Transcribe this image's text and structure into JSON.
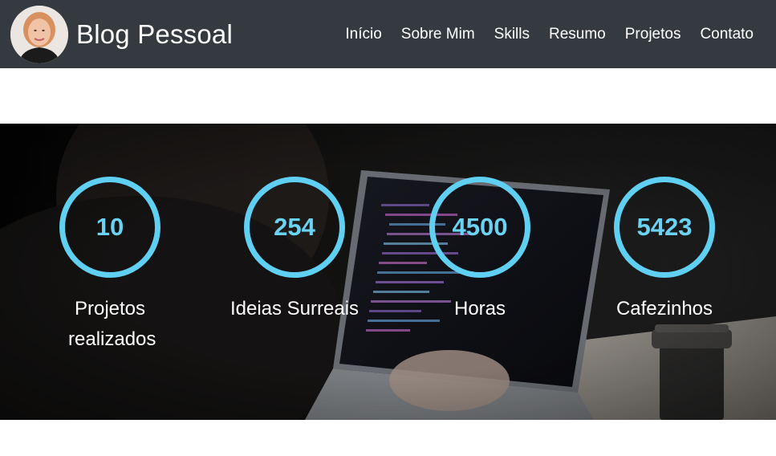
{
  "navbar": {
    "brand_title": "Blog Pessoal",
    "avatar_icon": "profile-photo",
    "links": [
      "Início",
      "Sobre Mim",
      "Skills",
      "Resumo",
      "Projetos",
      "Contato"
    ],
    "background_color": "#343a3f"
  },
  "stats": {
    "accent_color": "#5fd0f2",
    "items": [
      {
        "value": "10",
        "label": "Projetos realizados"
      },
      {
        "value": "254",
        "label": "Ideias Surreais"
      },
      {
        "value": "4500",
        "label": "Horas"
      },
      {
        "value": "5423",
        "label": "Cafezinhos"
      }
    ]
  }
}
